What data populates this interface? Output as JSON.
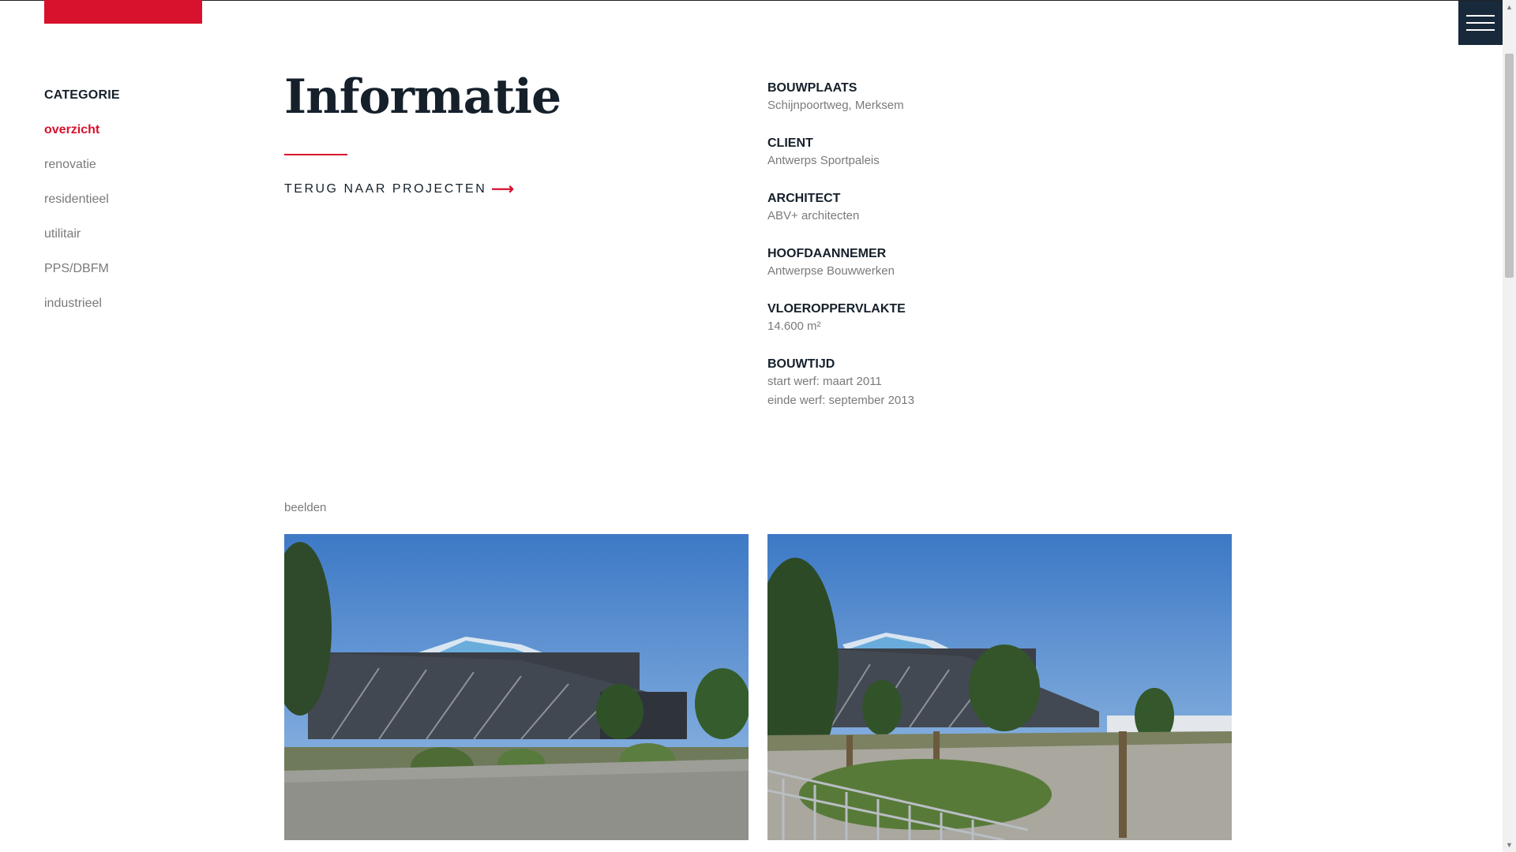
{
  "header": {
    "logo_color": "#d8112c",
    "menu_icon": "hamburger-icon",
    "menu_color": "#17293a"
  },
  "sidebar": {
    "title": "CATEGORIE",
    "items": [
      {
        "label": "overzicht",
        "active": true
      },
      {
        "label": "renovatie",
        "active": false
      },
      {
        "label": "residentieel",
        "active": false
      },
      {
        "label": "utilitair",
        "active": false
      },
      {
        "label": "PPS/DBFM",
        "active": false
      },
      {
        "label": "industrieel",
        "active": false
      }
    ]
  },
  "main": {
    "title": "Informatie",
    "back_link": "TERUG NAAR PROJECTEN",
    "back_icon": "arrow-right-icon"
  },
  "info": [
    {
      "label": "BOUWPLAATS",
      "value": "Schijnpoortweg, Merksem"
    },
    {
      "label": "CLIENT",
      "value": "Antwerps Sportpaleis"
    },
    {
      "label": "ARCHITECT",
      "value": "ABV+ architecten"
    },
    {
      "label": "HOOFDAANNEMER",
      "value": "Antwerpse Bouwwerken"
    },
    {
      "label": "VLOEROPPERVLAKTE",
      "value": "14.600 m²"
    },
    {
      "label": "BOUWTIJD",
      "value": "start werf: maart 2011",
      "value2": "einde werf: september 2013"
    }
  ],
  "gallery": {
    "label": "beelden"
  },
  "colors": {
    "accent": "#d8112c",
    "dark": "#15202b",
    "muted": "#7a7a7a"
  }
}
